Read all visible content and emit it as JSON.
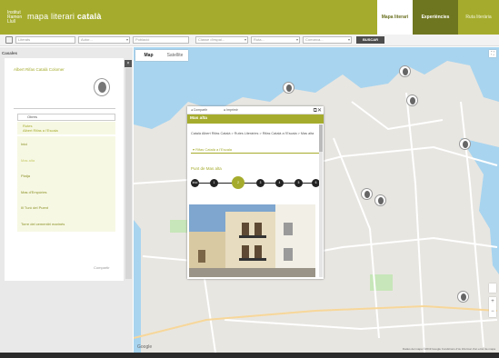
{
  "header": {
    "logo_text": "Institut Ramon Llull",
    "title_prefix": "mapa literari",
    "title_bold": "català",
    "nav": [
      {
        "label": "Mapa literari",
        "active": true
      },
      {
        "label": "Experiències",
        "active": false
      },
      {
        "label": "Ruta literària",
        "active": false
      }
    ]
  },
  "search": {
    "fields": [
      {
        "placeholder": "Literats"
      },
      {
        "placeholder": "Autor..."
      },
      {
        "placeholder": "Població"
      },
      {
        "placeholder": "Classe d'espai..."
      },
      {
        "placeholder": "Ruta..."
      },
      {
        "placeholder": "Comarca..."
      }
    ],
    "button_label": "BUSCAR"
  },
  "left_panel": {
    "label": "Casales",
    "author": "Albert Rifas Català Colomer",
    "select_value": "Obres",
    "groups": [
      "Rutes",
      "Albert Rifas a l'Escala"
    ],
    "points": [
      {
        "label": "Inici",
        "active": false
      },
      {
        "label": "Mas alta",
        "active": true
      },
      {
        "label": "Platja",
        "active": false
      },
      {
        "label": "Mas d'Empúries",
        "active": false
      },
      {
        "label": "Ill Turó del Puent",
        "active": false
      },
      {
        "label": "Torre del cementiri marinés",
        "active": false
      }
    ],
    "link": "Compartir"
  },
  "map": {
    "tabs": [
      "Map",
      "Satellite"
    ],
    "google": "Google",
    "credits": "Dades del mapa ©2019 Google  Condicions d'ús  Informar d'un error de mapa"
  },
  "popup": {
    "tools": [
      "Compartir",
      "Imprimir"
    ],
    "title": "Mas alta",
    "breadcrumb": "Català Albert Rifas Català > Rutes Literàries > Rifas Català a l'Escala > Mas alta",
    "field": "Rifas Català a l'Escala",
    "subtitle": "Punt de Mas alta",
    "steps": [
      "Inici",
      "1",
      "2",
      "3",
      "4",
      "5",
      "6"
    ],
    "active_step": 2
  },
  "colors": {
    "accent": "#a5ac2d",
    "dark_accent": "#6f7620"
  }
}
